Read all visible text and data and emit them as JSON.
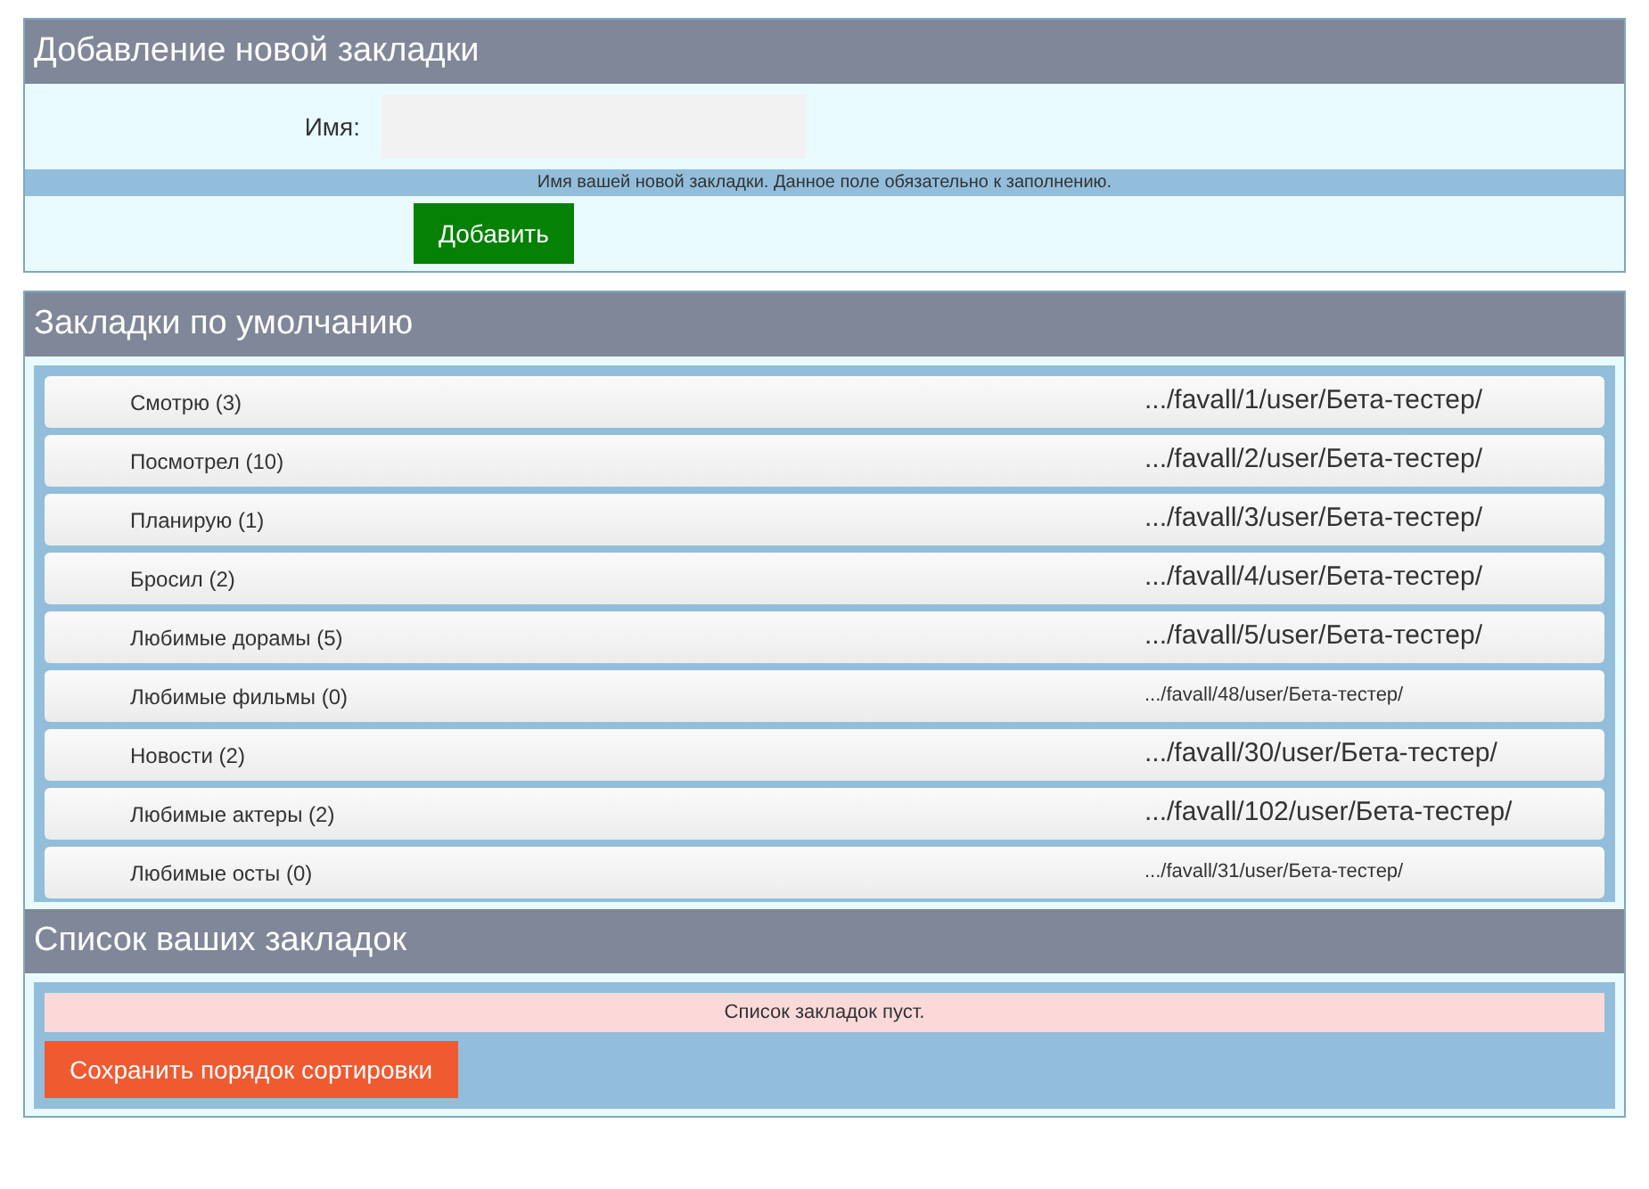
{
  "add_section": {
    "title": "Добавление новой закладки",
    "name_label": "Имя:",
    "hint": "Имя вашей новой закладки. Данное поле обязательно к заполнению.",
    "add_button": "Добавить"
  },
  "default_section": {
    "title": "Закладки по умолчанию",
    "items": [
      {
        "label": "Смотрю (3)",
        "link": ".../favall/1/user/Бета-тестер/",
        "kind": "large"
      },
      {
        "label": "Посмотрел (10)",
        "link": ".../favall/2/user/Бета-тестер/",
        "kind": "large"
      },
      {
        "label": "Планирую (1)",
        "link": ".../favall/3/user/Бета-тестер/",
        "kind": "large"
      },
      {
        "label": "Бросил (2)",
        "link": ".../favall/4/user/Бета-тестер/",
        "kind": "large"
      },
      {
        "label": "Любимые дорамы (5)",
        "link": ".../favall/5/user/Бета-тестер/",
        "kind": "large"
      },
      {
        "label": "Любимые фильмы (0)",
        "link": ".../favall/48/user/Бета-тестер/",
        "kind": "small"
      },
      {
        "label": "Новости (2)",
        "link": ".../favall/30/user/Бета-тестер/",
        "kind": "large"
      },
      {
        "label": "Любимые актеры (2)",
        "link": ".../favall/102/user/Бета-тестер/",
        "kind": "large"
      },
      {
        "label": "Любимые осты (0)",
        "link": ".../favall/31/user/Бета-тестер/",
        "kind": "small"
      }
    ]
  },
  "your_section": {
    "title": "Список ваших закладок",
    "empty_message": "Список закладок пуст.",
    "save_button": "Сохранить порядок сортировки"
  }
}
